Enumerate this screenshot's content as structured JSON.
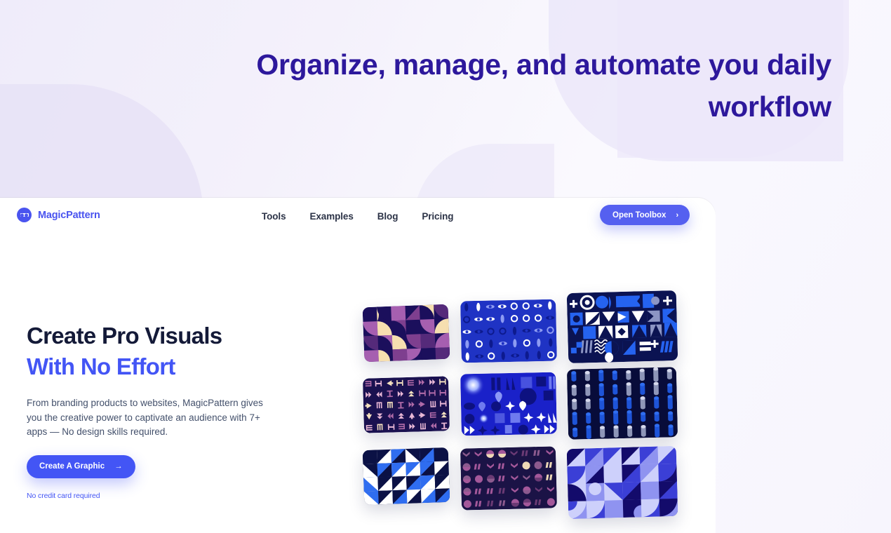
{
  "page": {
    "background_gradient_from": "#efecfa",
    "background_gradient_to": "#f7f5fd",
    "blob_color": "#e7e2f7"
  },
  "hero_banner": {
    "headline": "Organize, manage, and automate you daily workflow",
    "headline_color": "#2d189c"
  },
  "navbar": {
    "brand": {
      "name": "MagicPattern",
      "logo_icon": "magicpattern-logo-icon",
      "color": "#4a54ef"
    },
    "links": [
      {
        "label": "Tools"
      },
      {
        "label": "Examples"
      },
      {
        "label": "Blog"
      },
      {
        "label": "Pricing"
      }
    ],
    "cta": {
      "label": "Open Toolbox",
      "icon": "chevron-right-icon",
      "background": "#5560f0",
      "text_color": "#ffffff"
    }
  },
  "hero": {
    "title_line_1": "Create Pro Visuals",
    "title_line_2": "With No Effort",
    "title_line_1_color": "#141a38",
    "title_line_2_color": "#4355f5",
    "paragraph": "From branding products to websites, MagicPattern gives you the creative power to captivate an audience with 7+ apps — No design skills required.",
    "cta": {
      "label": "Create A Graphic",
      "icon": "arrow-right-icon",
      "background": "#4355f5",
      "text_color": "#ffffff"
    },
    "footnote": "No credit card required",
    "footnote_color": "#4355f5"
  },
  "pattern_gallery": {
    "cards": [
      {
        "name": "bauhaus-quarter-circles",
        "palette": [
          "#1b0f5c",
          "#7e3f8f",
          "#a65fb0",
          "#f6dfb0",
          "#552a7a"
        ]
      },
      {
        "name": "blue-dot-grid",
        "palette": [
          "#1f33c4",
          "#0d1a8e",
          "#ffffff",
          "#8d9bf2"
        ]
      },
      {
        "name": "blue-abstract-shapes",
        "palette": [
          "#0b1352",
          "#2563f0",
          "#ffffff",
          "#8c95c4"
        ]
      },
      {
        "name": "navy-rune-glyphs",
        "palette": [
          "#1a1150",
          "#e9b8d6",
          "#f4e0bf",
          "#b06ba8"
        ]
      },
      {
        "name": "blue-glow-glyphs",
        "palette": [
          "#1a21c9",
          "#0d1180",
          "#ffffff",
          "#6f7bef"
        ]
      },
      {
        "name": "navy-3d-cylinders",
        "palette": [
          "#080c3a",
          "#1e54d8",
          "#d6d9ec",
          "#8e96b8"
        ]
      },
      {
        "name": "blue-triangle-mosaic",
        "palette": [
          "#0b1145",
          "#2f6df0",
          "#ffffff"
        ]
      },
      {
        "name": "plum-circle-chevrons",
        "palette": [
          "#1b1346",
          "#a4589a",
          "#efd9b6",
          "#6b3a74"
        ]
      },
      {
        "name": "indigo-geometric-mosaic",
        "palette": [
          "#130b6b",
          "#3b3fd6",
          "#8f93f0",
          "#cdd0fb"
        ]
      }
    ]
  }
}
